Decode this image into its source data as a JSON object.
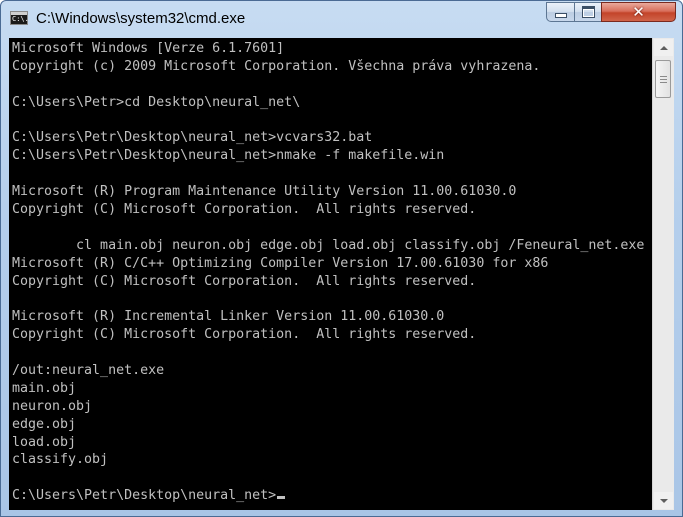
{
  "window": {
    "title": "C:\\Windows\\system32\\cmd.exe",
    "icon": "cmd-icon",
    "icon_text": "C:\\."
  },
  "controls": {
    "minimize": "minimize-icon",
    "maximize": "maximize-icon",
    "close": "close-icon",
    "close_glyph": "✕"
  },
  "console": {
    "background": "#000000",
    "foreground": "#c0c0c0",
    "lines": [
      "Microsoft Windows [Verze 6.1.7601]",
      "Copyright (c) 2009 Microsoft Corporation. Všechna práva vyhrazena.",
      "",
      "C:\\Users\\Petr>cd Desktop\\neural_net\\",
      "",
      "C:\\Users\\Petr\\Desktop\\neural_net>vcvars32.bat",
      "C:\\Users\\Petr\\Desktop\\neural_net>nmake -f makefile.win",
      "",
      "Microsoft (R) Program Maintenance Utility Version 11.00.61030.0",
      "Copyright (C) Microsoft Corporation.  All rights reserved.",
      "",
      "        cl main.obj neuron.obj edge.obj load.obj classify.obj /Feneural_net.exe",
      "Microsoft (R) C/C++ Optimizing Compiler Version 17.00.61030 for x86",
      "Copyright (C) Microsoft Corporation.  All rights reserved.",
      "",
      "Microsoft (R) Incremental Linker Version 11.00.61030.0",
      "Copyright (C) Microsoft Corporation.  All rights reserved.",
      "",
      "/out:neural_net.exe",
      "main.obj",
      "neuron.obj",
      "edge.obj",
      "load.obj",
      "classify.obj",
      ""
    ],
    "prompt": "C:\\Users\\Petr\\Desktop\\neural_net>"
  },
  "scrollbar": {
    "up": "scroll-up-arrow-icon",
    "down": "scroll-down-arrow-icon"
  }
}
